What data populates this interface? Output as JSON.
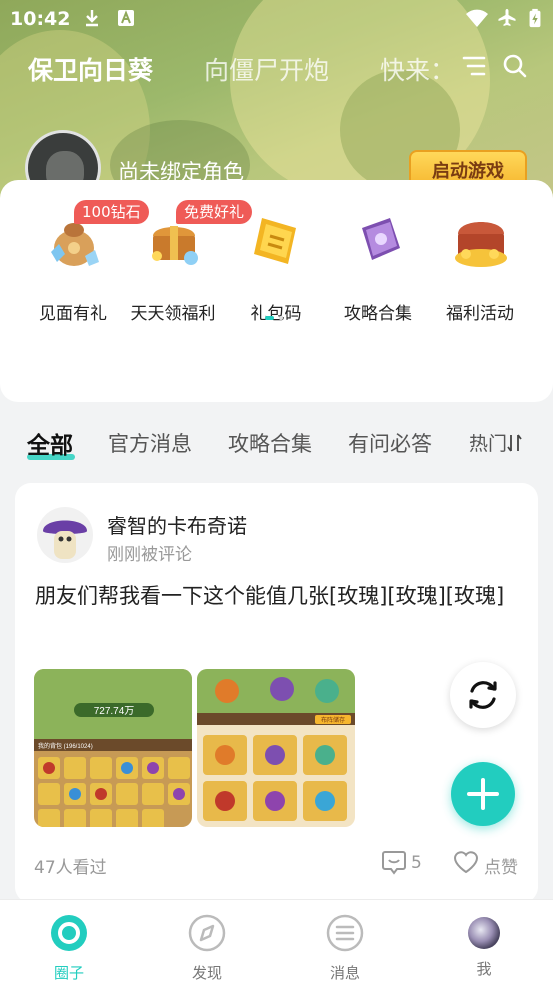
{
  "status_bar": {
    "time": "10:42"
  },
  "top_tabs": [
    "保卫向日葵",
    "向僵尸开炮",
    "快来：",
    ""
  ],
  "profile": {
    "name": "尚未绑定角色",
    "start_button": "启动游戏"
  },
  "quick_items": [
    {
      "label": "见面有礼",
      "badge": "100钻石"
    },
    {
      "label": "天天领福利",
      "badge": "免费好礼"
    },
    {
      "label": "礼包码",
      "badge": ""
    },
    {
      "label": "攻略合集",
      "badge": ""
    },
    {
      "label": "福利活动",
      "badge": ""
    }
  ],
  "categories": [
    "全部",
    "官方消息",
    "攻略合集",
    "有问必答",
    "热门"
  ],
  "post": {
    "author": "睿智的卡布奇诺",
    "time": "刚刚被评论",
    "text": "朋友们帮我看一下这个能值几张[玫瑰][玫瑰][玫瑰]",
    "views": "47人看过",
    "comments": "5",
    "like_label": "点赞",
    "thumb1_counter": "727.74万",
    "thumb1_bag": "我的背包 (196/1024)",
    "thumb2_button": "布阵储存"
  },
  "bottom_nav": [
    {
      "label": "圈子",
      "active": true
    },
    {
      "label": "发现",
      "active": false
    },
    {
      "label": "消息",
      "active": false
    },
    {
      "label": "我",
      "active": false
    }
  ],
  "colors": {
    "accent": "#22cdbf",
    "badge": "#ef5b57",
    "start_btn": "#f6b62e"
  }
}
